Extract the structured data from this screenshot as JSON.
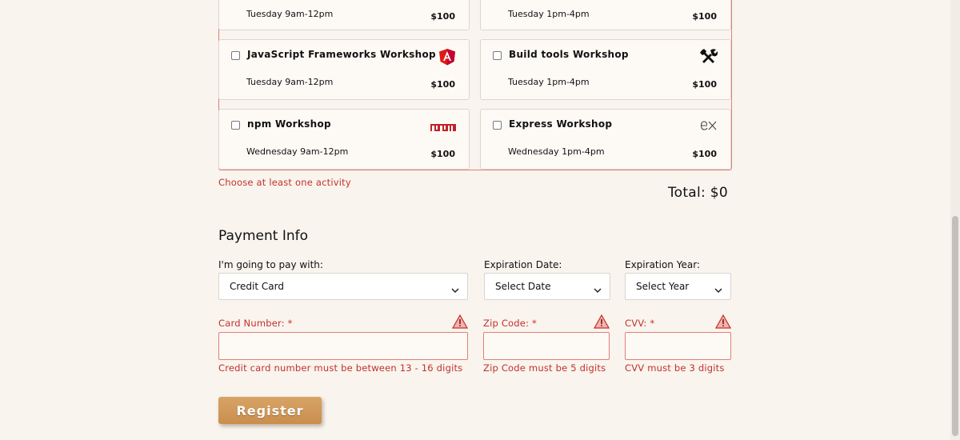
{
  "activities": [
    {
      "name": "",
      "time": "Tuesday 9am-12pm",
      "price": "$100",
      "icon": "none"
    },
    {
      "name": "",
      "time": "Tuesday 1pm-4pm",
      "price": "$100",
      "icon": "none"
    },
    {
      "name": "JavaScript Frameworks Workshop",
      "time": "Tuesday 9am-12pm",
      "price": "$100",
      "icon": "angular-icon"
    },
    {
      "name": "Build tools Workshop",
      "time": "Tuesday 1pm-4pm",
      "price": "$100",
      "icon": "tools-icon"
    },
    {
      "name": "npm Workshop",
      "time": "Wednesday 9am-12pm",
      "price": "$100",
      "icon": "npm-icon"
    },
    {
      "name": "Express Workshop",
      "time": "Wednesday 1pm-4pm",
      "price": "$100",
      "icon": "express-icon"
    }
  ],
  "activity_error": "Choose at least one activity",
  "total": "Total: $0",
  "payment": {
    "title": "Payment Info",
    "method_label": "I'm going to pay with:",
    "method_value": "Credit Card",
    "exp_date_label": "Expiration Date:",
    "exp_date_value": "Select Date",
    "exp_year_label": "Expiration Year:",
    "exp_year_value": "Select Year",
    "card_label": "Card Number: *",
    "zip_label": "Zip Code: *",
    "cvv_label": "CVV: *",
    "card_error": "Credit card number must be between 13 - 16 digits",
    "zip_error": "Zip Code must be 5 digits",
    "cvv_error": "CVV must be 3 digits"
  },
  "register_label": "Register",
  "colors": {
    "error": "#c4302b",
    "accent": "#d09a5a",
    "background": "#f9f4ee"
  }
}
